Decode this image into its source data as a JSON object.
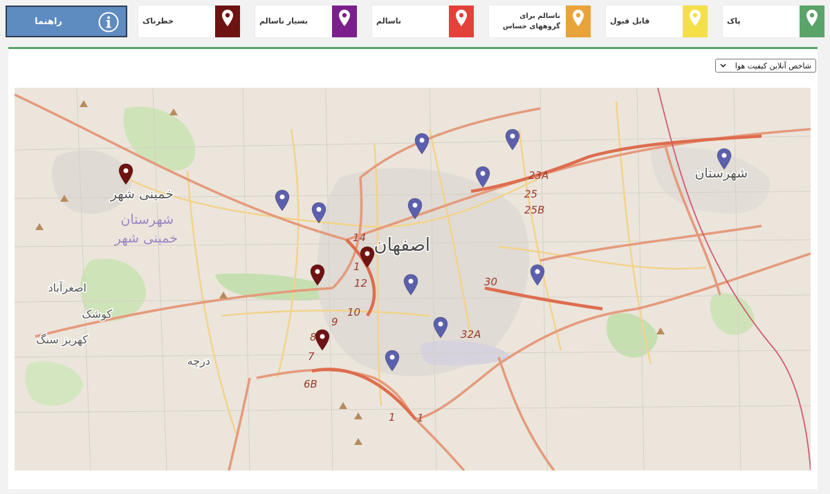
{
  "legend": [
    {
      "label": "پاک",
      "color": "#5aa469"
    },
    {
      "label": "قابل قبول",
      "color": "#f5e04a"
    },
    {
      "label": "ناسالم برای گروههای حساس",
      "color": "#e8a33a"
    },
    {
      "label": "ناسالم",
      "color": "#e2423a"
    },
    {
      "label": "بسیار ناسالم",
      "color": "#7b1f8c"
    },
    {
      "label": "خطرناک",
      "color": "#6e1212"
    }
  ],
  "guide_button": {
    "label": "راهنما",
    "icon": "info-icon"
  },
  "index_select": {
    "value": "شاخص آنلاین کیفیت هوا"
  },
  "map": {
    "labels": {
      "isfahan": "اصفهان",
      "khomeinishahr": "خمینی شهر",
      "shahrestan_khomeinishahr_1": "شهرستان",
      "shahrestan_khomeinishahr_2": "خمینی شهر",
      "shahrestan_east": "شهرستان",
      "esfarabad": "اصغرآباد",
      "kushk": "کوشک",
      "kahriz_sang": "کهریز سنگ",
      "darcheh": "درچه",
      "road_23a": "23A",
      "road_25": "25",
      "road_25b": "25B",
      "road_14": "14",
      "road_1x": "1",
      "road_12": "12",
      "road_10": "10",
      "road_9": "9",
      "road_8": "8",
      "road_7": "7",
      "road_6b": "6B",
      "road_30": "30",
      "road_32a": "32A",
      "road_1a": "1",
      "road_1b": "1"
    },
    "markers": [
      {
        "status": "clean-blue"
      },
      {
        "status": "clean-blue"
      },
      {
        "status": "clean-blue"
      },
      {
        "status": "clean-blue"
      },
      {
        "status": "clean-blue"
      },
      {
        "status": "clean-blue"
      },
      {
        "status": "clean-blue"
      },
      {
        "status": "clean-blue"
      },
      {
        "status": "clean-blue"
      },
      {
        "status": "clean-blue"
      },
      {
        "status": "clean-blue"
      },
      {
        "status": "hazardous"
      },
      {
        "status": "hazardous"
      },
      {
        "status": "hazardous"
      },
      {
        "status": "hazardous"
      }
    ],
    "marker_colors": {
      "clean-blue": "#5b5fad",
      "hazardous": "#6e1212"
    }
  }
}
